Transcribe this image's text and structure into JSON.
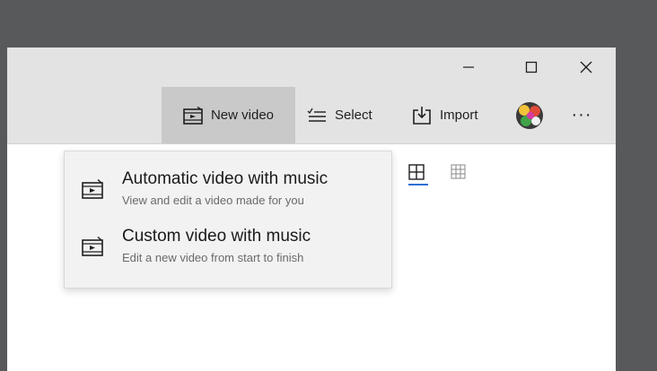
{
  "window_controls": {
    "minimize_icon": "minimize-icon",
    "maximize_icon": "maximize-icon",
    "close_icon": "close-icon"
  },
  "toolbar": {
    "new_video_label": "New video",
    "select_label": "Select",
    "import_label": "Import",
    "more_glyph": "···"
  },
  "menu": {
    "items": [
      {
        "title": "Automatic video with music",
        "subtitle": "View and edit a video made for you",
        "icon": "video-clip-icon"
      },
      {
        "title": "Custom video with music",
        "subtitle": "Edit a new video from start to finish",
        "icon": "video-clip-icon"
      }
    ]
  },
  "view_options": {
    "active": "large-grid-icon",
    "inactive": "small-grid-icon"
  },
  "colors": {
    "accent": "#2d6fd2",
    "toolbar": "#e3e3e3",
    "menu_bg": "#f2f2f2",
    "active_btn": "#c9c9c9"
  }
}
